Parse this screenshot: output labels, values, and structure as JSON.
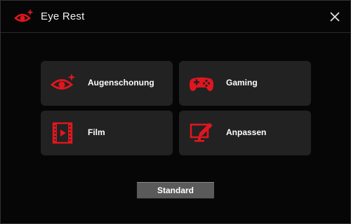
{
  "window": {
    "title": "Eye Rest",
    "app_icon": "eye-rest-icon",
    "close_icon": "close-icon"
  },
  "accent_color": "#e0161f",
  "modes": [
    {
      "label": "Augenschonung",
      "icon": "eye-icon"
    },
    {
      "label": "Gaming",
      "icon": "gamepad-icon"
    },
    {
      "label": "Film",
      "icon": "film-icon"
    },
    {
      "label": "Anpassen",
      "icon": "customize-monitor-icon"
    }
  ],
  "footer": {
    "standard_label": "Standard"
  }
}
